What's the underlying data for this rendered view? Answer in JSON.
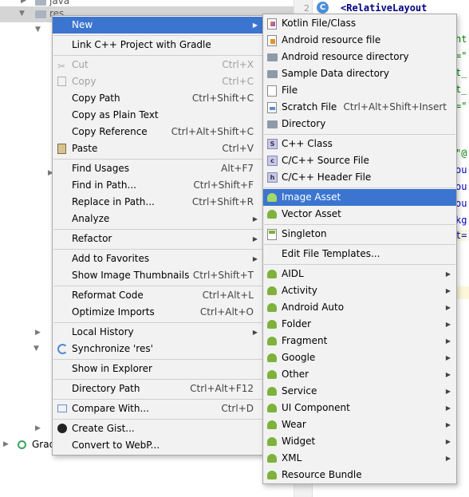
{
  "tree": {
    "items": [
      {
        "label": "java"
      },
      {
        "label": "res"
      },
      {
        "label": "Grad"
      }
    ]
  },
  "editor": {
    "line_number": "2",
    "class_badge": "C",
    "code_line": "<RelativeLayout",
    "fragments": [
      "ht",
      "=\"",
      "t_",
      "t_",
      "=\"",
      "\"@",
      "ou",
      "ou",
      "ou",
      "kg",
      "t="
    ]
  },
  "context_menu": {
    "items": [
      {
        "label": "New",
        "submenu": true,
        "active": true
      },
      {
        "label": "Link C++ Project with Gradle"
      },
      {
        "label": "Cut",
        "shortcut": "Ctrl+X",
        "disabled": true,
        "icon": "scissors-icon"
      },
      {
        "label": "Copy",
        "shortcut": "Ctrl+C",
        "disabled": true,
        "icon": "copy-icon"
      },
      {
        "label": "Copy Path",
        "shortcut": "Ctrl+Shift+C"
      },
      {
        "label": "Copy as Plain Text"
      },
      {
        "label": "Copy Reference",
        "shortcut": "Ctrl+Alt+Shift+C"
      },
      {
        "label": "Paste",
        "shortcut": "Ctrl+V",
        "icon": "clipboard-icon"
      },
      {
        "label": "Find Usages",
        "shortcut": "Alt+F7"
      },
      {
        "label": "Find in Path...",
        "shortcut": "Ctrl+Shift+F"
      },
      {
        "label": "Replace in Path...",
        "shortcut": "Ctrl+Shift+R"
      },
      {
        "label": "Analyze",
        "submenu": true
      },
      {
        "label": "Refactor",
        "submenu": true
      },
      {
        "label": "Add to Favorites",
        "submenu": true
      },
      {
        "label": "Show Image Thumbnails",
        "shortcut": "Ctrl+Shift+T"
      },
      {
        "label": "Reformat Code",
        "shortcut": "Ctrl+Alt+L"
      },
      {
        "label": "Optimize Imports",
        "shortcut": "Ctrl+Alt+O"
      },
      {
        "label": "Local History",
        "submenu": true
      },
      {
        "label": "Synchronize 'res'",
        "icon": "sync-icon"
      },
      {
        "label": "Show in Explorer"
      },
      {
        "label": "Directory Path",
        "shortcut": "Ctrl+Alt+F12"
      },
      {
        "label": "Compare With...",
        "shortcut": "Ctrl+D"
      },
      {
        "label": "Create Gist...",
        "icon": "github-icon"
      },
      {
        "label": "Convert to WebP..."
      }
    ]
  },
  "new_submenu": {
    "items": [
      {
        "label": "Kotlin File/Class",
        "icon": "kotlin-file-icon"
      },
      {
        "label": "Android resource file",
        "icon": "resource-file-icon"
      },
      {
        "label": "Android resource directory",
        "icon": "folder-icon"
      },
      {
        "label": "Sample Data directory",
        "icon": "folder-icon"
      },
      {
        "label": "File",
        "icon": "file-icon"
      },
      {
        "label": "Scratch File",
        "shortcut": "Ctrl+Alt+Shift+Insert",
        "icon": "scratch-file-icon"
      },
      {
        "label": "Directory",
        "icon": "folder-icon"
      },
      {
        "label": "C++ Class",
        "icon": "cpp-class-icon"
      },
      {
        "label": "C/C++ Source File",
        "icon": "cpp-source-icon"
      },
      {
        "label": "C/C++ Header File",
        "icon": "cpp-header-icon"
      },
      {
        "label": "Image Asset",
        "icon": "android-icon",
        "active": true
      },
      {
        "label": "Vector Asset",
        "icon": "android-icon"
      },
      {
        "label": "Singleton",
        "icon": "singleton-icon"
      },
      {
        "label": "Edit File Templates..."
      },
      {
        "label": "AIDL",
        "icon": "android-icon",
        "submenu": true
      },
      {
        "label": "Activity",
        "icon": "android-icon",
        "submenu": true
      },
      {
        "label": "Android Auto",
        "icon": "android-icon",
        "submenu": true
      },
      {
        "label": "Folder",
        "icon": "android-icon",
        "submenu": true
      },
      {
        "label": "Fragment",
        "icon": "android-icon",
        "submenu": true
      },
      {
        "label": "Google",
        "icon": "android-icon",
        "submenu": true
      },
      {
        "label": "Other",
        "icon": "android-icon",
        "submenu": true
      },
      {
        "label": "Service",
        "icon": "android-icon",
        "submenu": true
      },
      {
        "label": "UI Component",
        "icon": "android-icon",
        "submenu": true
      },
      {
        "label": "Wear",
        "icon": "android-icon",
        "submenu": true
      },
      {
        "label": "Widget",
        "icon": "android-icon",
        "submenu": true
      },
      {
        "label": "XML",
        "icon": "android-icon",
        "submenu": true
      },
      {
        "label": "Resource Bundle",
        "icon": "resource-bundle-icon"
      }
    ]
  },
  "colors": {
    "selection": "#3b75d0",
    "menu_bg": "#f2f2f2",
    "android_green": "#7fb13d"
  }
}
